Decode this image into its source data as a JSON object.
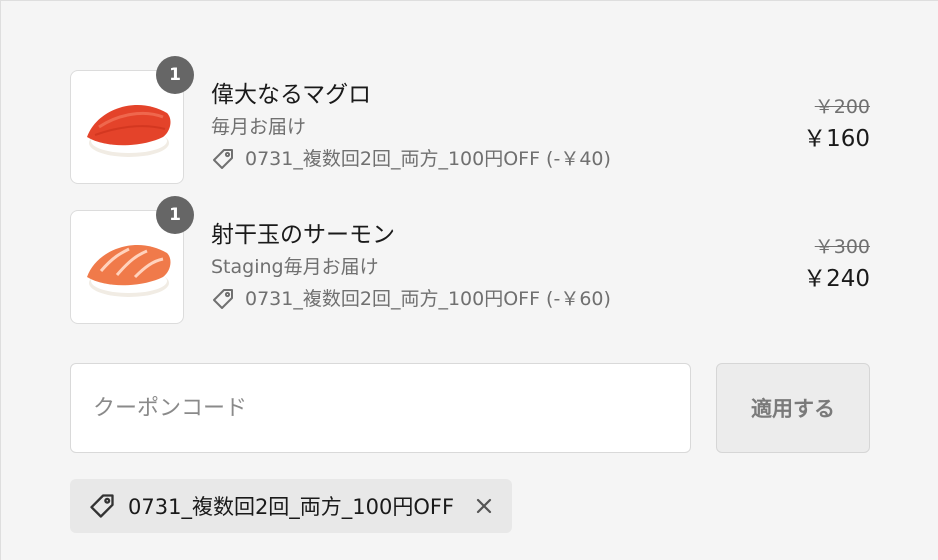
{
  "line_items": [
    {
      "quantity": "1",
      "title": "偉大なるマグロ",
      "variant": "毎月お届け",
      "discount": "0731_複数回2回_両方_100円OFF (-￥40)",
      "original_price": "￥200",
      "final_price": "￥160",
      "image": "tuna-nigiri-image",
      "fish_color": "#e4432a"
    },
    {
      "quantity": "1",
      "title": "射干玉のサーモン",
      "variant": "Staging毎月お届け",
      "discount": "0731_複数回2回_両方_100円OFF (-￥60)",
      "original_price": "￥300",
      "final_price": "￥240",
      "image": "salmon-nigiri-image",
      "fish_color": "#f07a4a"
    }
  ],
  "coupon": {
    "placeholder": "クーポンコード",
    "value": "",
    "apply_label": "適用する"
  },
  "applied_coupon": {
    "code": "0731_複数回2回_両方_100円OFF",
    "tag_icon": "tag-icon",
    "remove_icon": "close-icon"
  },
  "colors": {
    "background": "#f5f5f5",
    "badge": "#666666",
    "muted_text": "#707070",
    "applied_coupon_bg": "#e8e8e8"
  }
}
